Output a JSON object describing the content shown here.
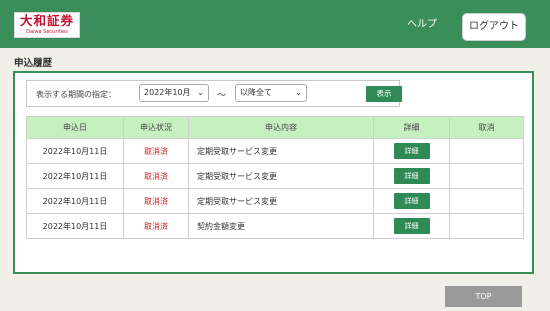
{
  "header": {
    "logo_text": "大和証券",
    "logo_sub": "Daiwa Securities",
    "help_label": "ヘルプ",
    "logout_label": "ログアウト"
  },
  "page": {
    "title": "申込履歴"
  },
  "filter": {
    "label": "表示する期間の指定：",
    "month_value": "2022年10月",
    "tilde": "～",
    "range_value": "以降全て",
    "show_label": "表示"
  },
  "table": {
    "columns": [
      "申込日",
      "申込状況",
      "申込内容",
      "詳細",
      "取消"
    ],
    "rows": [
      {
        "date": "2022年10月11日",
        "status": "取消済",
        "content": "定期受取サービス変更",
        "detail": "詳細",
        "cancel": ""
      },
      {
        "date": "2022年10月11日",
        "status": "取消済",
        "content": "定期受取サービス変更",
        "detail": "詳細",
        "cancel": ""
      },
      {
        "date": "2022年10月11日",
        "status": "取消済",
        "content": "定期受取サービス変更",
        "detail": "詳細",
        "cancel": ""
      },
      {
        "date": "2022年10月11日",
        "status": "取消済",
        "content": "契約金額変更",
        "detail": "詳細",
        "cancel": ""
      }
    ]
  },
  "footer": {
    "top_label": "TOP"
  },
  "colors": {
    "header_green": "#3a8e5a",
    "button_green": "#2f8a55",
    "table_header_bg": "#c6f0c0",
    "status_red": "#d11e1e",
    "top_button_gray": "#9a9a9a"
  }
}
